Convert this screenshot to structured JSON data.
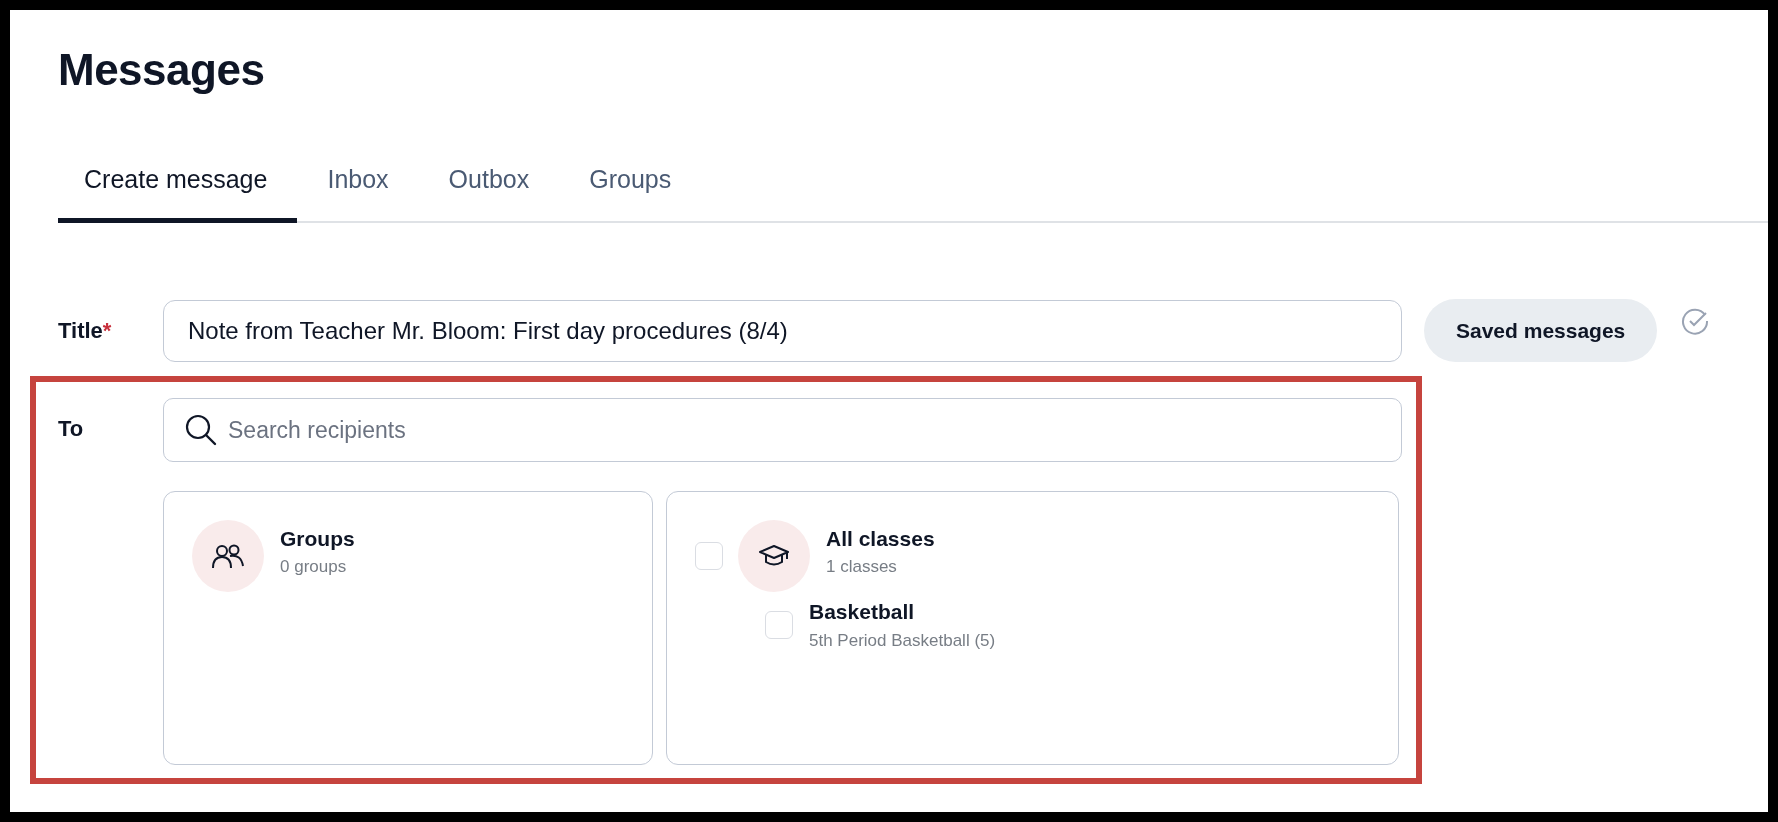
{
  "heading": "Messages",
  "tabs": [
    {
      "label": "Create message",
      "selected": true
    },
    {
      "label": "Inbox",
      "selected": false
    },
    {
      "label": "Outbox",
      "selected": false
    },
    {
      "label": "Groups",
      "selected": false
    }
  ],
  "title_field": {
    "label": "Title",
    "required_mark": "*",
    "value": "Note from Teacher Mr. Bloom: First day procedures (8/4)"
  },
  "saved_button": "Saved messages",
  "to_field": {
    "label": "To",
    "placeholder": "Search recipients"
  },
  "groups_card": {
    "title": "Groups",
    "subtitle": "0 groups"
  },
  "classes_card": {
    "title": "All classes",
    "subtitle": "1 classes",
    "checked": false,
    "classes": [
      {
        "name": "Basketball",
        "detail": "5th Period Basketball (5)",
        "checked": false
      }
    ]
  }
}
